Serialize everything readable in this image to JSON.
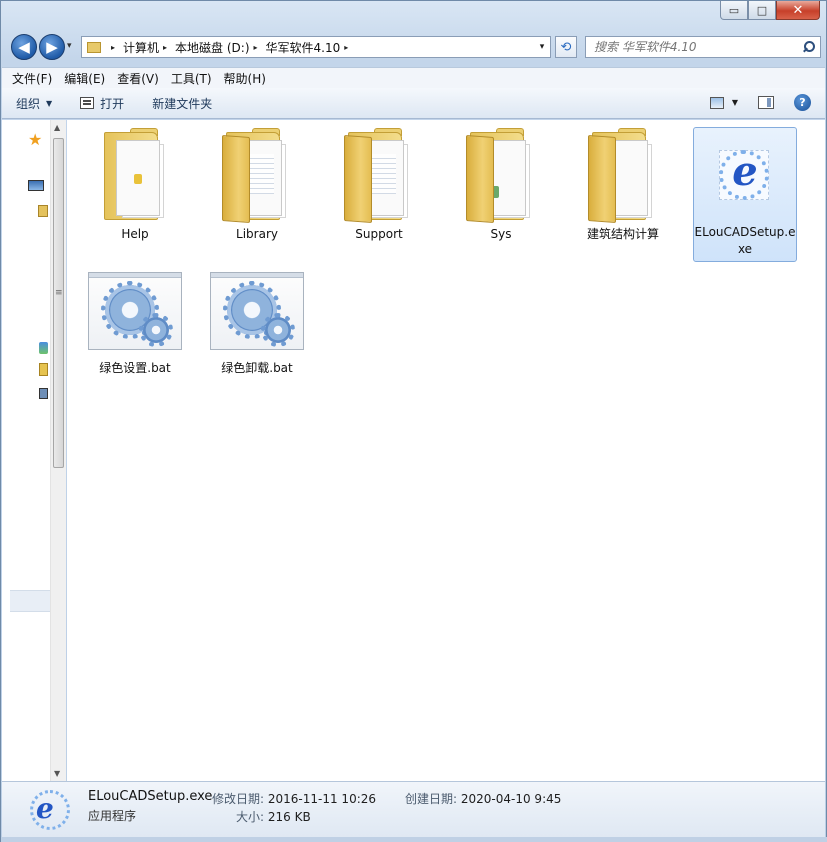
{
  "window": {
    "minimize": "▭",
    "maximize": "□",
    "close": "✕"
  },
  "nav": {
    "back": "◀",
    "forward": "▶",
    "dropdown": "▾"
  },
  "address": {
    "breadcrumbs": [
      "计算机",
      "本地磁盘 (D:)",
      "华军软件4.10"
    ],
    "separator": "▸"
  },
  "search": {
    "placeholder": "搜索 华军软件4.10"
  },
  "menu": {
    "items": [
      "文件(F)",
      "编辑(E)",
      "查看(V)",
      "工具(T)",
      "帮助(H)"
    ]
  },
  "toolbar": {
    "organize": "组织",
    "open": "打开",
    "new_folder": "新建文件夹",
    "help": "?"
  },
  "files": [
    {
      "name": "Help",
      "kind": "folder"
    },
    {
      "name": "Library",
      "kind": "folder"
    },
    {
      "name": "Support",
      "kind": "folder"
    },
    {
      "name": "Sys",
      "kind": "folder"
    },
    {
      "name": "建筑结构计算",
      "kind": "folder"
    },
    {
      "name": "ELouCADSetup.exe",
      "kind": "exe",
      "selected": true
    },
    {
      "name": "绿色设置.bat",
      "kind": "bat"
    },
    {
      "name": "绿色卸载.bat",
      "kind": "bat"
    }
  ],
  "details": {
    "name": "ELouCADSetup.exe",
    "type": "应用程序",
    "modified_label": "修改日期:",
    "modified_value": "2016-11-11 10:26",
    "created_label": "创建日期:",
    "created_value": "2020-04-10 9:45",
    "size_label": "大小:",
    "size_value": "216 KB"
  },
  "colors": {
    "selection": "#cfe3fa",
    "selection_border": "#84acdd",
    "folder": "#f0d174"
  }
}
